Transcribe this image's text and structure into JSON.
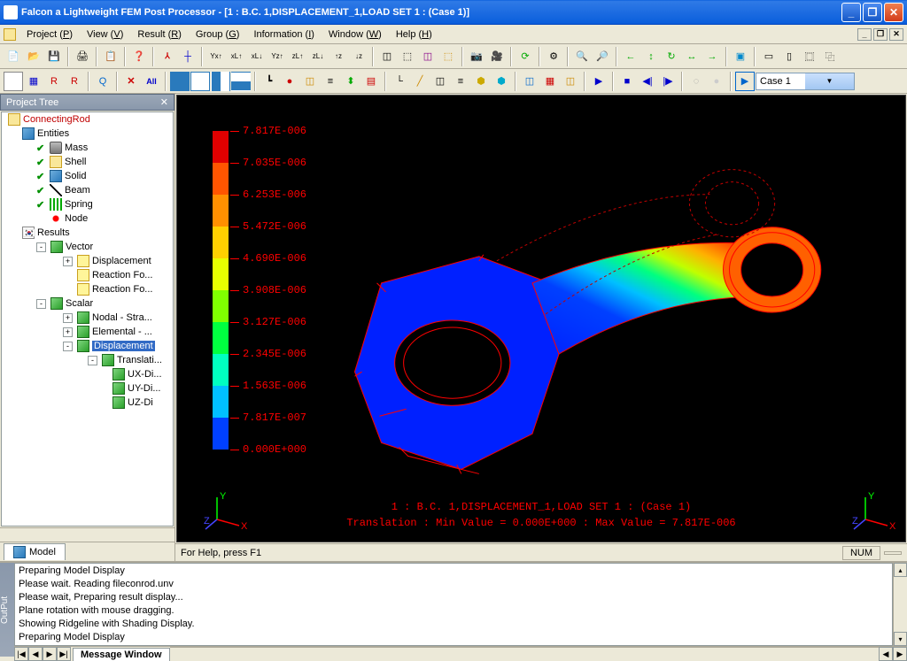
{
  "window": {
    "title": "Falcon a Lightweight FEM Post Processor - [1 : B.C. 1,DISPLACEMENT_1,LOAD SET 1  :  (Case 1)]"
  },
  "menu": {
    "items": [
      "Project (P)",
      "View (V)",
      "Result (R)",
      "Group (G)",
      "Information (I)",
      "Window (W)",
      "Help (H)"
    ]
  },
  "case_combo": "Case 1",
  "project_tree": {
    "title": "Project Tree",
    "root": "ConnectingRod",
    "entities_label": "Entities",
    "entities": [
      "Mass",
      "Shell",
      "Solid",
      "Beam",
      "Spring",
      "Node"
    ],
    "results_label": "Results",
    "vector_label": "Vector",
    "vector_items": [
      "Displacement",
      "Reaction Fo...",
      "Reaction Fo..."
    ],
    "scalar_label": "Scalar",
    "scalar_items": [
      "Nodal - Stra...",
      "Elemental - ...",
      "Displacement"
    ],
    "translati_label": "Translati...",
    "translati_items": [
      "UX-Di...",
      "UY-Di...",
      "UZ-Di"
    ]
  },
  "model_tab": "Model",
  "legend": {
    "values": [
      "7.817E-006",
      "7.035E-006",
      "6.253E-006",
      "5.472E-006",
      "4.690E-006",
      "3.908E-006",
      "3.127E-006",
      "2.345E-006",
      "1.563E-006",
      "7.817E-007",
      "0.000E+000"
    ],
    "colors": [
      "#e00000",
      "#ff5500",
      "#ff9000",
      "#ffd000",
      "#e8ff00",
      "#80ff00",
      "#00ff40",
      "#00ffc0",
      "#00c0ff",
      "#0040ff"
    ]
  },
  "viewport": {
    "line1": "1 : B.C. 1,DISPLACEMENT_1,LOAD SET 1  :  (Case 1)",
    "line2": "Translation : Min Value = 0.000E+000 : Max Value = 7.817E-006"
  },
  "status": {
    "help": "For Help, press F1",
    "num": "NUM"
  },
  "output": {
    "title": "OutPut",
    "lines": [
      "Preparing Model Display",
      "Please wait. Reading fileconrod.unv",
      "Please wait, Preparing result display...",
      "Plane rotation with mouse dragging.",
      "Showing Ridgeline with Shading Display.",
      "Preparing Model Display"
    ],
    "tab": "Message Window"
  },
  "chart_data": {
    "type": "scalar_field_legend",
    "title": "Translation (Displacement)",
    "min": 0.0,
    "max": 7.817e-06,
    "ticks": [
      0.0,
      7.817e-07,
      1.563e-06,
      2.345e-06,
      3.127e-06,
      3.908e-06,
      4.69e-06,
      5.472e-06,
      6.253e-06,
      7.035e-06,
      7.817e-06
    ],
    "colormap": [
      "#0040ff",
      "#00c0ff",
      "#00ffc0",
      "#00ff40",
      "#80ff00",
      "#e8ff00",
      "#ffd000",
      "#ff9000",
      "#ff5500",
      "#e00000"
    ]
  }
}
